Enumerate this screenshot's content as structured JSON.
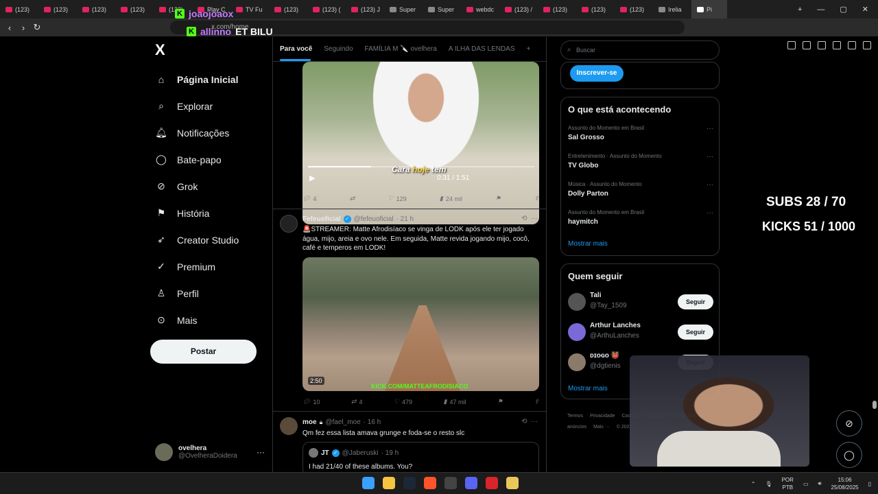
{
  "browser": {
    "tabs": [
      {
        "label": "(123)",
        "icon": "youtube-icon"
      },
      {
        "label": "(123)",
        "icon": "youtube-icon"
      },
      {
        "label": "(123)",
        "icon": "youtube-icon"
      },
      {
        "label": "(123)",
        "icon": "youtube-icon"
      },
      {
        "label": "(123)",
        "icon": "youtube-icon"
      },
      {
        "label": "Play C",
        "icon": "youtube-icon"
      },
      {
        "label": "TV Fu",
        "icon": "youtube-icon"
      },
      {
        "label": "(123)",
        "icon": "youtube-icon"
      },
      {
        "label": "(123) (",
        "icon": "youtube-icon"
      },
      {
        "label": "(123) J",
        "icon": "youtube-icon"
      },
      {
        "label": "Super",
        "icon": "doc-icon"
      },
      {
        "label": "Super",
        "icon": "doc-icon"
      },
      {
        "label": "webdc",
        "icon": "youtube-icon"
      },
      {
        "label": "(123) /",
        "icon": "youtube-icon"
      },
      {
        "label": "(123)",
        "icon": "youtube-icon"
      },
      {
        "label": "(123)",
        "icon": "youtube-icon"
      },
      {
        "label": "(123)",
        "icon": "youtube-icon"
      },
      {
        "label": "Irelia",
        "icon": "doc-icon"
      },
      {
        "label": "Pi",
        "icon": "x-icon"
      }
    ],
    "url": "x.com/home"
  },
  "stream": {
    "line1": "joaojoaox",
    "line2_a": "allinno",
    "line2_b": "ET BILU",
    "subs": "SUBS 28 / 70",
    "kicks": "KICKS 51 / 1000"
  },
  "nav": {
    "logo": "X",
    "items": [
      {
        "label": "Página Inicial",
        "icon": "home-icon",
        "active": true
      },
      {
        "label": "Explorar",
        "icon": "search-icon"
      },
      {
        "label": "Notificações",
        "icon": "bell-icon"
      },
      {
        "label": "Bate-papo",
        "icon": "chat-icon"
      },
      {
        "label": "Grok",
        "icon": "grok-icon"
      },
      {
        "label": "História",
        "icon": "bookmark-icon"
      },
      {
        "label": "Creator Studio",
        "icon": "rocket-icon"
      },
      {
        "label": "Premium",
        "icon": "verified-icon"
      },
      {
        "label": "Perfil",
        "icon": "person-icon"
      },
      {
        "label": "Mais",
        "icon": "more-circle-icon"
      }
    ],
    "post": "Postar",
    "user": {
      "name": "ovelhera",
      "handle": "@OvelheraDoidera"
    }
  },
  "timeline": {
    "tabs": [
      "Para você",
      "Seguindo",
      "FAMÍLIA M 🔪 ovelhera",
      "A ILHA DAS LENDAS"
    ],
    "add": "+",
    "video1": {
      "caption_a": "Cara",
      "caption_b": "hoje",
      "caption_c": "tem",
      "time": "0:31 / 1:51",
      "progress": 0.28,
      "actions": {
        "replies": "4",
        "likes": "129",
        "views": "24 mil"
      }
    },
    "tweet1": {
      "name": "Fefeuoficial",
      "handle": "@fefeuoficial",
      "time": "· 21 h",
      "text": "🚨STREAMER: Matte Afrodisíaco se vinga de LODK após ele ter jogado água, mijo, areia e ovo nele. Em seguida, Matte revida jogando mijo, cocô, café e temperos em LODK!",
      "video_duration": "2:50",
      "watermark": "KICK.COM/MATTEAFRODISIACO",
      "actions": {
        "replies": "10",
        "reposts": "4",
        "likes": "479",
        "views": "47 mil"
      }
    },
    "tweet2": {
      "name": "moe",
      "handle": "@fael_moe",
      "time": "· 16 h",
      "text": "Qm fez essa lista amava grunge e foda-se o resto slc",
      "quote": {
        "name": "JT",
        "handle": "@Jaberuski",
        "time": "· 19 h",
        "text": "I had 21/40 of these albums. You?"
      }
    }
  },
  "sidebar": {
    "search_placeholder": "Buscar",
    "subscribe": "Inscrever-se",
    "trends_title": "O que está acontecendo",
    "trends": [
      {
        "meta": "Assunto do Momento em Brasil",
        "name": "Sal Grosso"
      },
      {
        "meta": "Entretenimento · Assunto do Momento",
        "name": "TV Globo"
      },
      {
        "meta": "Música · Assunto do Momento",
        "name": "Dolly Parton"
      },
      {
        "meta": "Assunto do Momento em Brasil",
        "name": "haymitch"
      }
    ],
    "show_more": "Mostrar mais",
    "follow_title": "Quem seguir",
    "follow": [
      {
        "name": "Tali",
        "handle": "@Tay_1509",
        "button": "Seguir"
      },
      {
        "name": "Arthur Lanches",
        "handle": "@ArthuLanches",
        "button": "Seguir"
      },
      {
        "name": "ᴅɪᴏɢᴏ 👹",
        "handle": "@dgtienis",
        "button": "Seguir"
      }
    ],
    "footer": [
      "Termos",
      "Privacidade",
      "Cookies",
      "Acessib",
      "Informações de anúncios",
      "Mais ···",
      "© 2025"
    ]
  },
  "taskbar": {
    "lang1": "POR",
    "lang2": "PTB",
    "time": "15:06",
    "date": "25/08/2025"
  }
}
